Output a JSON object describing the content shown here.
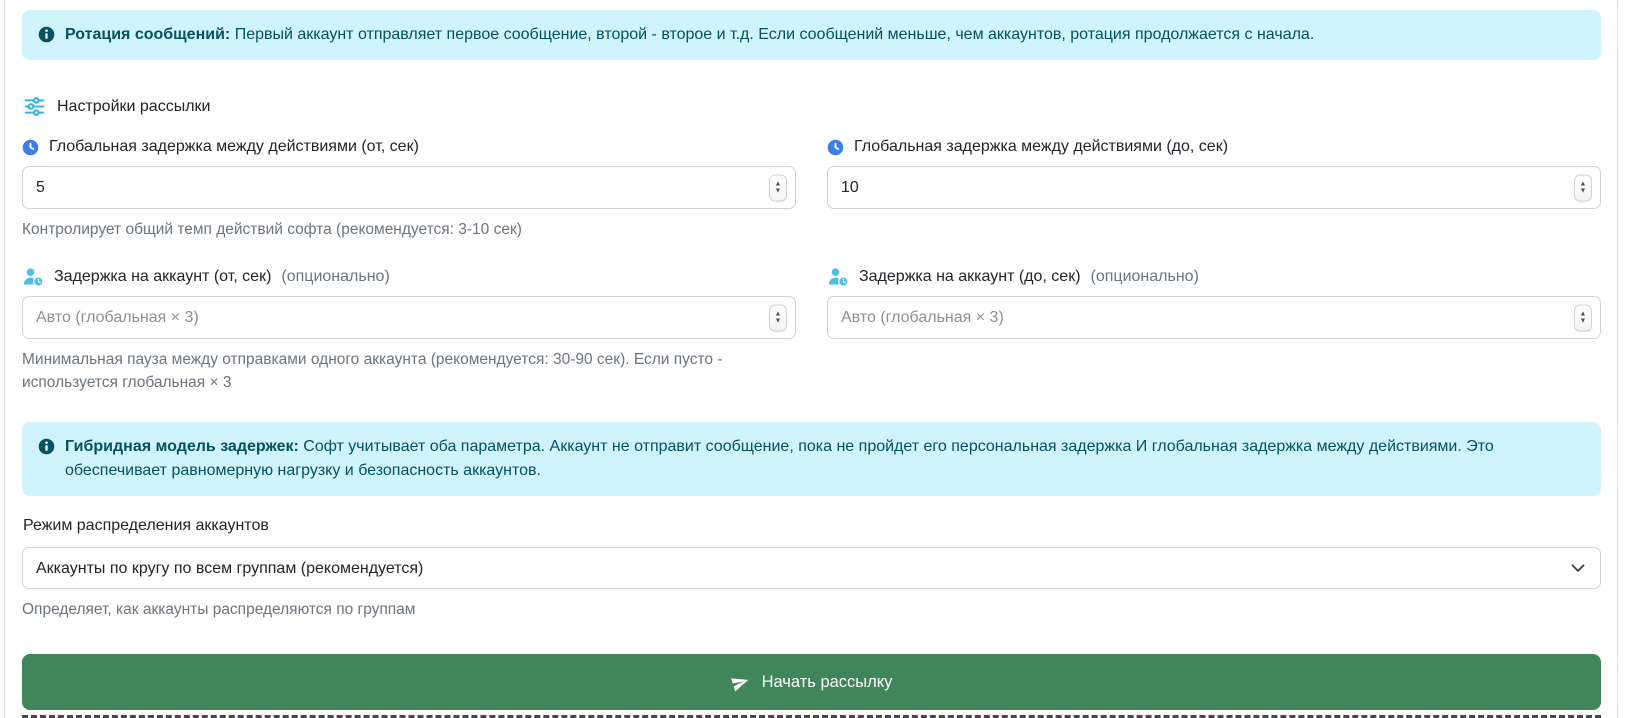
{
  "alerts": {
    "rotation": {
      "title": "Ротация сообщений:",
      "text": "Первый аккаунт отправляет первое сообщение, второй - второе и т.д. Если сообщений меньше, чем аккаунтов, ротация продолжается с начала."
    },
    "hybrid": {
      "title": "Гибридная модель задержек:",
      "text": "Софт учитывает оба параметра. Аккаунт не отправит сообщение, пока не пройдет его персональная задержка И глобальная задержка между действиями. Это обеспечивает равномерную нагрузку и безопасность аккаунтов."
    }
  },
  "section": {
    "title": "Настройки рассылки"
  },
  "fields": {
    "global_from": {
      "label": "Глобальная задержка между действиями (от, сек)",
      "value": "5",
      "help": "Контролирует общий темп действий софта (рекомендуется: 3-10 сек)"
    },
    "global_to": {
      "label": "Глобальная задержка между действиями (до, сек)",
      "value": "10"
    },
    "account_from": {
      "label": "Задержка на аккаунт (от, сек)",
      "optional": "(опционально)",
      "placeholder": "Авто (глобальная × 3)",
      "help": "Минимальная пауза между отправками одного аккаунта (рекомендуется: 30-90 сек). Если пусто - используется глобальная × 3"
    },
    "account_to": {
      "label": "Задержка на аккаунт (до, сек)",
      "optional": "(опционально)",
      "placeholder": "Авто (глобальная × 3)"
    }
  },
  "distribution": {
    "label": "Режим распределения аккаунтов",
    "selected": "Аккаунты по кругу по всем группам (рекомендуется)",
    "help": "Определяет, как аккаунты распределяются по группам"
  },
  "actions": {
    "start_button": "Начать рассылку"
  },
  "icons": {
    "info": "info-circle-icon",
    "sliders": "sliders-icon",
    "clock": "clock-icon",
    "user_clock": "user-clock-icon",
    "send": "paper-plane-icon",
    "chevron": "chevron-down-icon"
  },
  "colors": {
    "alert_bg": "#cff4fc",
    "alert_text": "#055160",
    "clock_blue": "#3b7de9",
    "user_light_blue": "#4fbde4",
    "sliders_blue": "#3eb3e0",
    "button_green": "#41855a",
    "muted_text": "#6c757d",
    "input_border": "#ced4da"
  }
}
